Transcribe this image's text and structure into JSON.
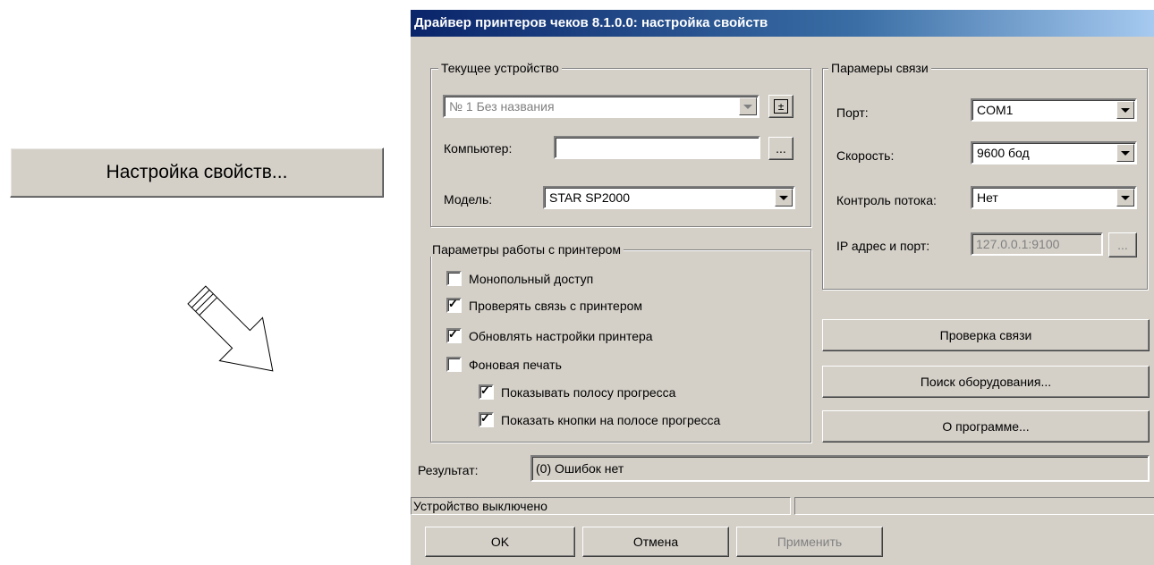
{
  "launcher": {
    "label": "Настройка свойств..."
  },
  "dialog": {
    "title": "Драйвер принтеров чеков 8.1.0.0: настройка свойств",
    "current_device": {
      "group_title": "Текущее устройство",
      "device_value": "№ 1 Без названия",
      "device_button": "±",
      "computer_label": "Компьютер:",
      "computer_value": "",
      "browse_label": "...",
      "model_label": "Модель:",
      "model_value": "STAR SP2000"
    },
    "connection": {
      "group_title": "Парамеры связи",
      "port_label": "Порт:",
      "port_value": "COM1",
      "speed_label": "Скорость:",
      "speed_value": "9600 бод",
      "flow_label": "Контроль потока:",
      "flow_value": "Нет",
      "ip_label": "IP адрес и порт:",
      "ip_value": "127.0.0.1:9100",
      "ip_browse": "..."
    },
    "printer_params": {
      "group_title": "Параметры работы с принтером",
      "options": [
        {
          "label": "Монопольный доступ",
          "checked": false
        },
        {
          "label": "Проверять связь с принтером",
          "checked": true
        },
        {
          "label": "Обновлять настройки принтера",
          "checked": true
        },
        {
          "label": "Фоновая печать",
          "checked": false
        },
        {
          "label": "Показывать полосу прогресса",
          "checked": true
        },
        {
          "label": "Показать кнопки на полосе прогресса",
          "checked": true
        }
      ],
      "check_mark": "✓"
    },
    "actions": {
      "check_connection": "Проверка связи",
      "search_equipment": "Поиск оборудования...",
      "about": "О программе..."
    },
    "result": {
      "label": "Результат:",
      "value": "(0) Ошибок нет"
    },
    "status": {
      "text": "Устройство выключено"
    },
    "buttons": {
      "ok": "OK",
      "cancel": "Отмена",
      "apply": "Применить"
    }
  }
}
